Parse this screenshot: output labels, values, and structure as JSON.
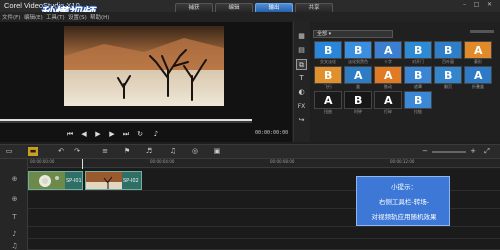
{
  "app": {
    "title": "Corel VideoStudio X10"
  },
  "watermark": {
    "text": "秒懂视频"
  },
  "menu": {
    "items": [
      "文件(F)",
      "编辑(E)",
      "工具(T)",
      "设置(S)",
      "帮助(H)"
    ]
  },
  "tabs": [
    {
      "label": "捕获",
      "active": false
    },
    {
      "label": "编辑",
      "active": false
    },
    {
      "label": "输出",
      "active": true
    },
    {
      "label": "共享",
      "active": false
    }
  ],
  "window_controls": {
    "minimize": "–",
    "maximize": "□",
    "close": "✕"
  },
  "player": {
    "timecode": "00:00:00:00",
    "progress": 1.0,
    "controls": [
      "home-icon",
      "prev-frame-icon",
      "play-icon",
      "next-frame-icon",
      "end-icon",
      "repeat-icon",
      "volume-icon"
    ]
  },
  "side_tools": [
    "media-icon",
    "instant-project-icon",
    "transition-icon",
    "title-icon",
    "graphic-icon",
    "fx-icon",
    "path-icon"
  ],
  "side_tool_labels": {
    "fx": "FX"
  },
  "library": {
    "category": "全部",
    "thumbs": [
      {
        "caption": "交叉淡化",
        "letter": "B",
        "color": "#2a86d8"
      },
      {
        "caption": "淡化到黑色",
        "letter": "B",
        "color": "#3a8fe0"
      },
      {
        "caption": "十字",
        "letter": "A",
        "color": "#3a7fd0"
      },
      {
        "caption": "对开门",
        "letter": "B",
        "color": "#2f8ad4"
      },
      {
        "caption": "百叶窗",
        "letter": "B",
        "color": "#2e7fc8"
      },
      {
        "caption": "菱形",
        "letter": "A",
        "color": "#e08a2a"
      },
      {
        "caption": "飞行",
        "letter": "B",
        "color": "#e0902c"
      },
      {
        "caption": "盒",
        "letter": "A",
        "color": "#2e7cc4"
      },
      {
        "caption": "推动",
        "letter": "A",
        "color": "#e07a24"
      },
      {
        "caption": "遮罩",
        "letter": "B",
        "color": "#3a86d4"
      },
      {
        "caption": "翻页",
        "letter": "B",
        "color": "#3585cc"
      },
      {
        "caption": "折叠盒",
        "letter": "A",
        "color": "#2d7ac6"
      },
      {
        "caption": "扭曲",
        "letter": "A",
        "color": "#1a1a1a"
      },
      {
        "caption": "时钟",
        "letter": "B",
        "color": "#161616"
      },
      {
        "caption": "打碎",
        "letter": "A",
        "color": "#1c1c1c"
      },
      {
        "caption": "拉链",
        "letter": "B",
        "color": "#3a88d6"
      }
    ]
  },
  "timeline": {
    "ruler_marks": [
      "00:00:00:00",
      "00:00:04:00",
      "00:00:08:00",
      "00:00:12:00"
    ],
    "clips": [
      {
        "label": "SP-I01",
        "kind": "flower"
      },
      {
        "label": "SP-I02",
        "kind": "tree"
      }
    ],
    "track_icons": [
      "video-track-icon",
      "overlay-track-icon",
      "title-track-icon",
      "voice-track-icon",
      "music-track-icon"
    ]
  },
  "tip": {
    "lines": [
      "小提示：",
      "右侧工具栏-转场-",
      "对视频轨应用随机效果"
    ]
  },
  "colors": {
    "accent": "#3e78d6",
    "active_tab": "#3a82d6",
    "clip": "#2f6f66"
  }
}
